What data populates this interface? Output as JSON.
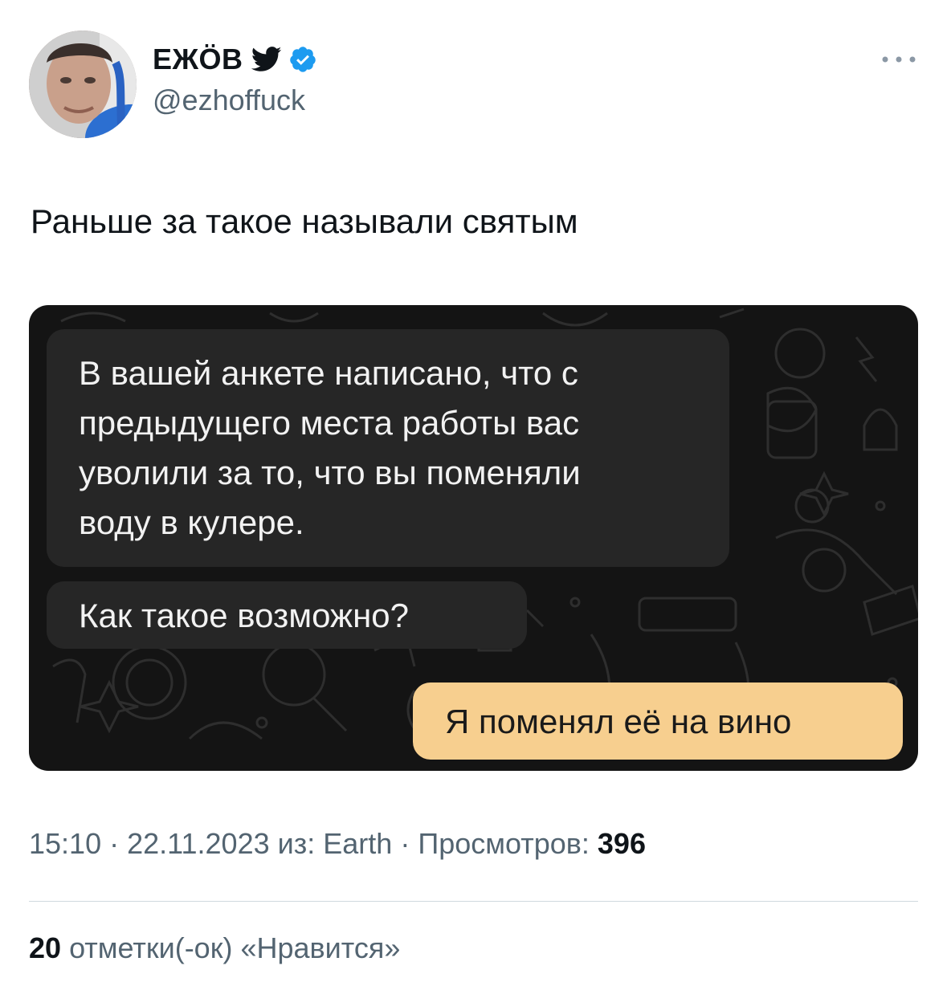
{
  "author": {
    "name": "ЕЖӦВ",
    "handle": "@ezhoffuck",
    "verified": true
  },
  "tweet": {
    "text": "Раньше за такое называли святым"
  },
  "media": {
    "bubble1_lines": [
      "В вашей анкете написано, что с",
      "предыдущего места работы вас",
      "уволили за то, что вы поменяли",
      "воду в кулере."
    ],
    "bubble2": "Как такое возможно?",
    "reply": "Я поменял её на вино"
  },
  "meta": {
    "time": "15:10",
    "date": "22.11.2023",
    "source": "из: Earth",
    "views_label": "Просмотров:",
    "views": "396"
  },
  "likes": {
    "count": "20",
    "label": "отметки(-ок) «Нравится»"
  },
  "colors": {
    "accent": "#1d9bf0",
    "reply_bubble": "#f7cf8f",
    "chat_background": "#141414"
  }
}
